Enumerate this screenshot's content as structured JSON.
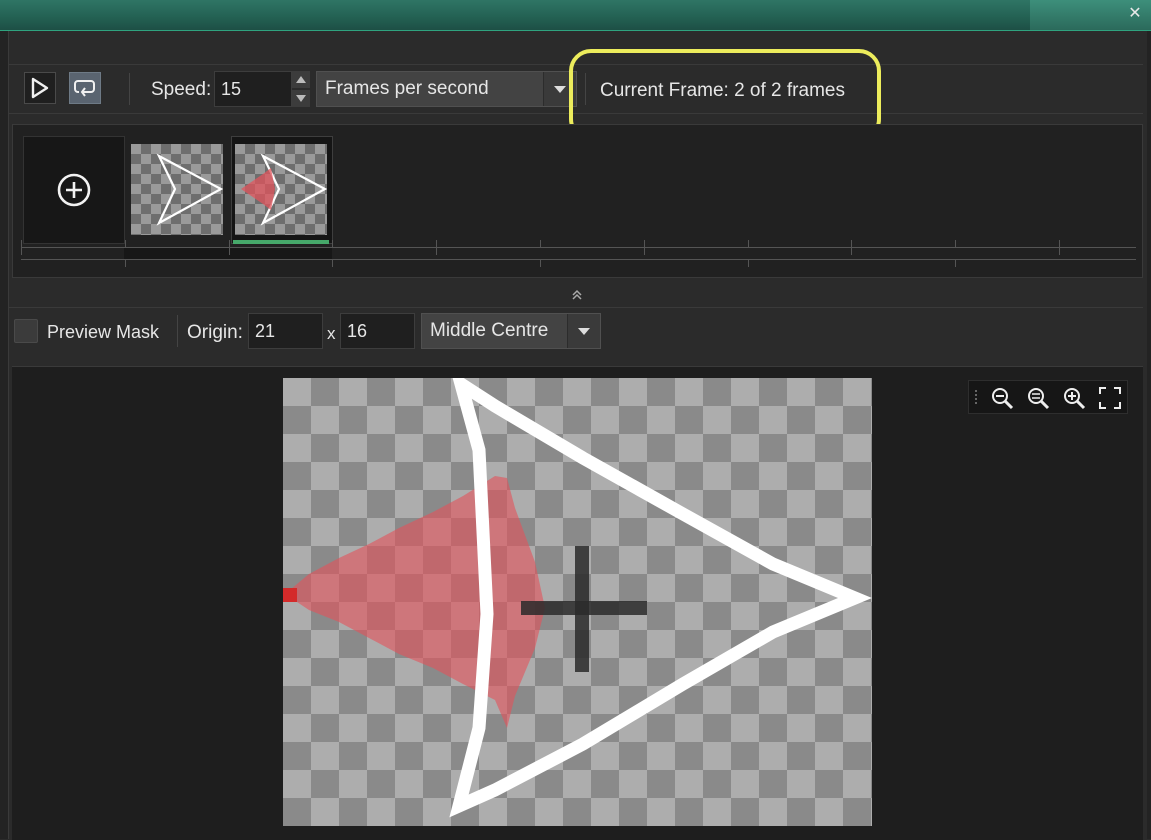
{
  "window": {
    "close_icon": "close-icon"
  },
  "toolbar": {
    "play_icon": "play-icon",
    "loop_icon": "loop-icon",
    "speed_label": "Speed:",
    "speed_value": "15",
    "speed_unit_selected": "Frames per second",
    "current_frame_text": "Current Frame: 2 of 2 frames"
  },
  "frames": {
    "add_icon": "plus-circle-icon",
    "count": 2,
    "selected_index": 2
  },
  "origin_bar": {
    "preview_mask_label": "Preview Mask",
    "preview_mask_checked": false,
    "origin_label": "Origin:",
    "origin_x": "21",
    "x_separator": "x",
    "origin_y": "16",
    "origin_preset": "Middle Centre"
  },
  "zoom_controls": [
    "zoom-out-icon",
    "zoom-reset-icon",
    "zoom-in-icon",
    "fit-screen-icon"
  ],
  "colors": {
    "accent_green": "#46a86a",
    "highlight_yellow": "#ecec5c",
    "mask_red": "#e2545c",
    "titlebar_teal": "#236052"
  }
}
